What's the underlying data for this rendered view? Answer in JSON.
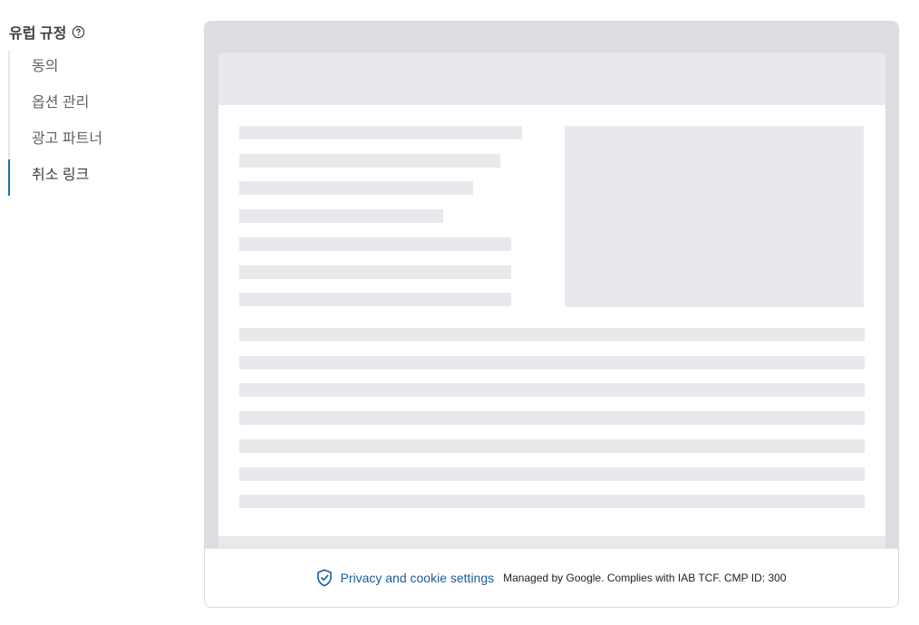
{
  "sidebar": {
    "title": "유럽 규정",
    "items": [
      {
        "label": "동의"
      },
      {
        "label": "옵션 관리"
      },
      {
        "label": "광고 파트너"
      },
      {
        "label": "취소 링크"
      }
    ]
  },
  "consent_bar": {
    "link_label": "Privacy and cookie settings",
    "managed_text": "Managed by Google. Complies with IAB TCF. CMP ID: 300"
  },
  "icons": {
    "help": "help-circle-icon",
    "shield": "shield-check-icon"
  },
  "colors": {
    "accent": "#1b6fa8",
    "link": "#1a5b9c",
    "placeholder": "#e8e9ec"
  }
}
